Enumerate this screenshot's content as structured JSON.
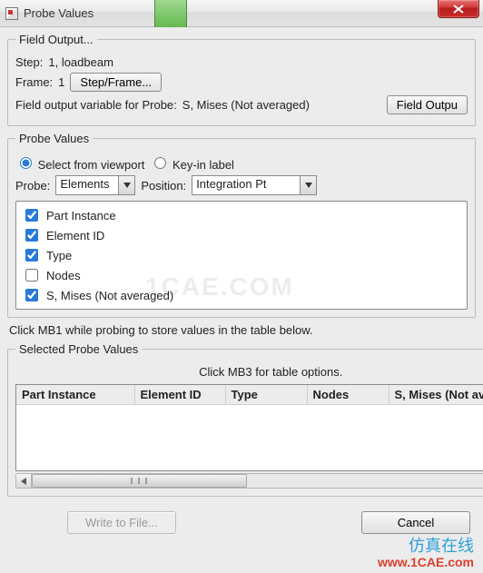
{
  "window": {
    "title": "Probe Values"
  },
  "fieldOutput": {
    "legend": "Field Output...",
    "stepLabel": "Step:",
    "stepValue": "1, loadbeam",
    "frameLabel": "Frame:",
    "frameValue": "1",
    "stepFrameBtn": "Step/Frame...",
    "variableLabel": "Field output variable for Probe:",
    "variableValue": "S, Mises (Not averaged)",
    "fieldOutputBtn": "Field Outpu"
  },
  "probeValues": {
    "legend": "Probe Values",
    "radioViewport": "Select from viewport",
    "radioKeyin": "Key-in label",
    "radioSelected": "viewport",
    "probeLabel": "Probe:",
    "probeValue": "Elements",
    "positionLabel": "Position:",
    "positionValue": "Integration Pt",
    "checks": [
      {
        "label": "Part Instance",
        "checked": true
      },
      {
        "label": "Element ID",
        "checked": true
      },
      {
        "label": "Type",
        "checked": true
      },
      {
        "label": "Nodes",
        "checked": false
      },
      {
        "label": "S, Mises (Not averaged)",
        "checked": true
      }
    ],
    "hint": "Click MB1 while probing to store values in the table below."
  },
  "selected": {
    "legend": "Selected Probe Values",
    "caption": "Click MB3 for table options.",
    "columns": [
      "Part Instance",
      "Element ID",
      "Type",
      "Nodes",
      "S, Mises (Not ave"
    ]
  },
  "buttons": {
    "write": "Write to File...",
    "cancel": "Cancel"
  },
  "watermark": {
    "center": "1CAE.COM",
    "brand": "仿真在线",
    "url": "www.1CAE.com"
  }
}
